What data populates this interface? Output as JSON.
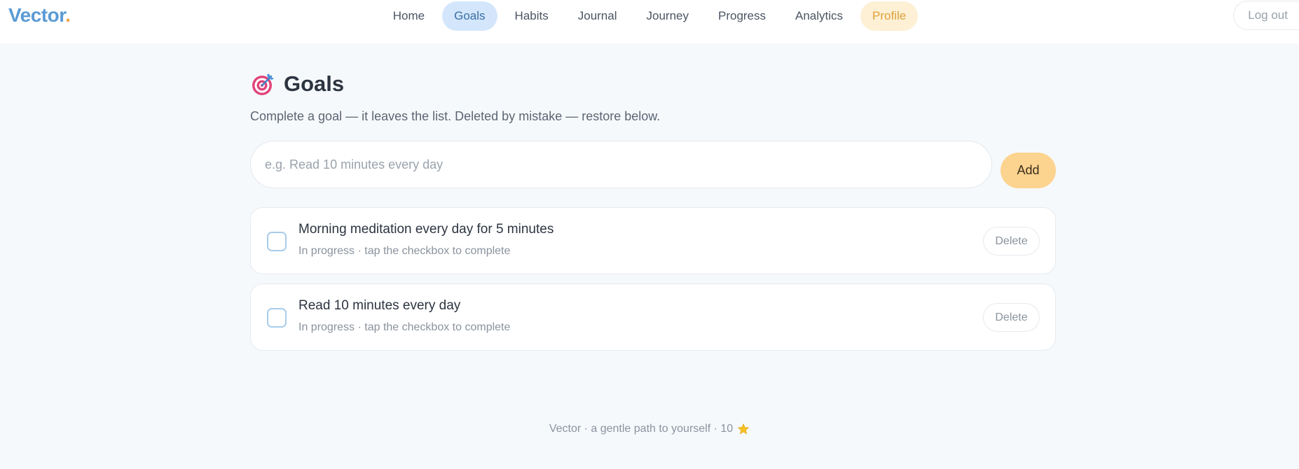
{
  "header": {
    "logo": "Vector",
    "logo_dot": ".",
    "nav": [
      {
        "label": "Home"
      },
      {
        "label": "Goals"
      },
      {
        "label": "Habits"
      },
      {
        "label": "Journal"
      },
      {
        "label": "Journey"
      },
      {
        "label": "Progress"
      },
      {
        "label": "Analytics"
      },
      {
        "label": "Profile"
      }
    ],
    "logout": "Log out"
  },
  "page": {
    "icon": "target-icon",
    "title": "Goals",
    "subtitle": "Complete a goal — it leaves the list. Deleted by mistake — restore below."
  },
  "add_goal": {
    "placeholder": "e.g. Read 10 minutes every day",
    "value": "",
    "button": "Add"
  },
  "goals": [
    {
      "title": "Morning meditation every day for 5 minutes",
      "status": "In progress · tap the checkbox to complete",
      "delete": "Delete",
      "done": false
    },
    {
      "title": "Read 10 minutes every day",
      "status": "In progress · tap the checkbox to complete",
      "delete": "Delete",
      "done": false
    }
  ],
  "footer": {
    "text": "Vector · a gentle path to yourself · 10",
    "icon": "star-icon"
  },
  "colors": {
    "accent": "#5b9bd5",
    "brand_dot": "#f2a343",
    "active_nav_bg": "#d3e6fb",
    "profile_bg": "#fdf0d5",
    "add_button_bg": "#fcd38f",
    "page_bg": "#f6f9fc"
  }
}
